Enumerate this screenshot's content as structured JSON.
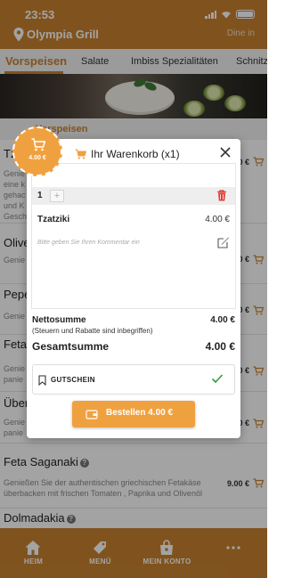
{
  "status_bar": {
    "time": "23:53"
  },
  "header": {
    "restaurant_name": "Olympia Grill",
    "mode": "Dine in"
  },
  "categories": [
    {
      "label": "Vorspeisen",
      "active": true
    },
    {
      "label": "Salate",
      "active": false
    },
    {
      "label": "Imbiss Spezialitäten",
      "active": false
    },
    {
      "label": "Schnitze",
      "active": false
    }
  ],
  "section": {
    "title": "Vorspeisen"
  },
  "menu_items": [
    {
      "name": "Tz",
      "description_lines": [
        "Genie",
        "eine k",
        "gehac",
        "und K",
        "Gesch"
      ],
      "price": "4.00 €"
    },
    {
      "name": "Olive",
      "description_lines": [
        "Genie"
      ],
      "price": "4.00 €"
    },
    {
      "name": "Pepe",
      "description_lines": [
        "Genie"
      ],
      "price": "4.00 €"
    },
    {
      "name": "Feta",
      "description_lines": [
        "Genie",
        "panie"
      ],
      "price": "9.00 €"
    },
    {
      "name": "Überb",
      "description_lines": [
        "Genie",
        "panie"
      ],
      "price": "9.00 €"
    },
    {
      "name": "Feta Saganaki",
      "description_lines": [
        "Genießen Sie der authentischen griechischen Fetakäse",
        "überbacken mit frischen Tomaten , Paprika und Olivenöl"
      ],
      "price": "9.00 €"
    },
    {
      "name": "Dolmadakia",
      "description_lines": [],
      "price": ""
    }
  ],
  "cart_badge": {
    "price": "4.00 €"
  },
  "cart_modal": {
    "title": "Ihr Warenkorb (x1)",
    "line_items": [
      {
        "quantity": "1",
        "plus_label": "+",
        "name": "Tzatziki",
        "price": "4.00 €",
        "comment_placeholder": "Bitte geben Sie Ihren Kommentar ein"
      }
    ],
    "subtotal_label": "Nettosumme",
    "subtotal_value": "4.00 €",
    "tax_note": "(Steuern und Rabatte sind inbegriffen)",
    "total_label": "Gesamtsumme",
    "total_value": "4.00 €",
    "voucher_label": "GUTSCHEIN",
    "order_button": "Bestellen 4.00 €"
  },
  "bottom_nav": [
    {
      "label": "HEIM",
      "icon": "home-icon"
    },
    {
      "label": "MENÜ",
      "icon": "tag-icon"
    },
    {
      "label": "MEIN KONTO",
      "icon": "bag-icon"
    },
    {
      "label": "",
      "icon": "more-icon"
    }
  ],
  "colors": {
    "brand": "#c9832f",
    "accent": "#f0a13f",
    "danger": "#e53935",
    "check": "#2e9e3e"
  }
}
